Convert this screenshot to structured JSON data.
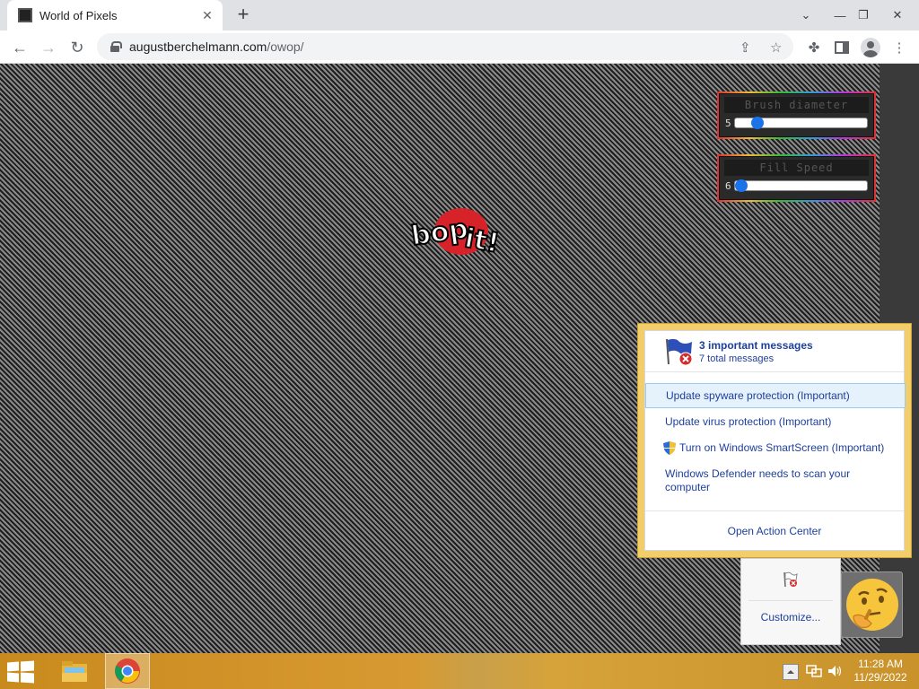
{
  "browser": {
    "tab_title": "World of Pixels",
    "url_host": "augustberchelmann.com",
    "url_path": "/owop/"
  },
  "tools": [
    {
      "title": "Brush diameter",
      "value": "5",
      "fraction": 0.17
    },
    {
      "title": "Fill Speed",
      "value": "6",
      "fraction": 0.05
    }
  ],
  "canvas": {
    "logo_text": "bop it!"
  },
  "action_center": {
    "header_title": "3 important messages",
    "header_sub": "7 total messages",
    "items": [
      "Update spyware protection (Important)",
      "Update virus protection (Important)",
      "Turn on Windows SmartScreen (Important)",
      "Windows Defender needs to scan your computer"
    ],
    "footer": "Open Action Center"
  },
  "overflow": {
    "customize": "Customize..."
  },
  "taskbar": {
    "time": "11:28 AM",
    "date": "11/29/2022"
  },
  "colors": {
    "link_blue": "#1e3f9c",
    "flyout_border": "#f2cd6b",
    "taskbar": "#d79a32"
  }
}
